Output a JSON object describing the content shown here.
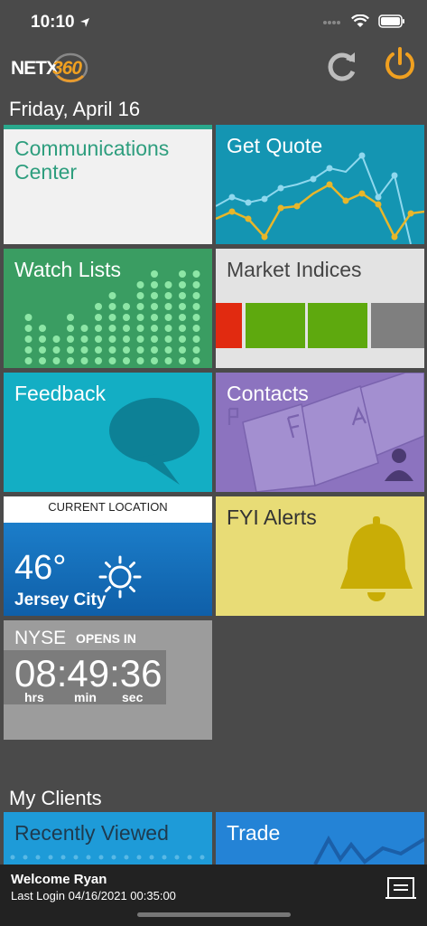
{
  "status": {
    "time": "10:10"
  },
  "header": {
    "logo_text": "NETX",
    "logo_num": "360"
  },
  "date": "Friday, April 16",
  "tiles": {
    "communications": "Communications Center",
    "quote": "Get Quote",
    "watch": "Watch Lists",
    "indices": "Market Indices",
    "feedback": "Feedback",
    "contacts": "Contacts",
    "location": {
      "header": "CURRENT LOCATION",
      "temp": "46°",
      "city": "Jersey City"
    },
    "fyi": "FYI Alerts",
    "nyse": {
      "label": "NYSE",
      "opens_in": "OPENS IN",
      "countdown": "08:49:36",
      "units": [
        "hrs",
        "min",
        "sec"
      ]
    }
  },
  "clients": {
    "heading": "My Clients",
    "recent": "Recently Viewed",
    "trade": "Trade"
  },
  "footer": {
    "welcome": "Welcome Ryan",
    "last_login_label": "Last Login",
    "last_login": "04/16/2021 00:35:00"
  },
  "colors": {
    "power_accent": "#f0a020",
    "comm_accent": "#2aa98d"
  }
}
